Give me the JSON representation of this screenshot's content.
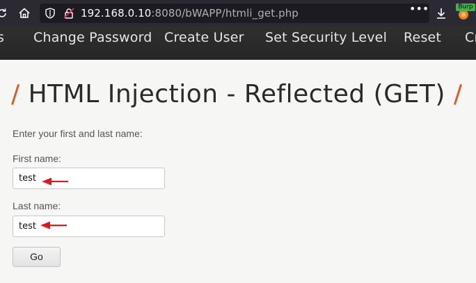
{
  "browser": {
    "url_host": "192.168.0.10",
    "url_port": ":8080",
    "url_path": "/bWAPP/htmli_get.php",
    "more_label": "•••",
    "burp_label": "Burp"
  },
  "nav": {
    "items": [
      {
        "label": "s"
      },
      {
        "label": "Change Password"
      },
      {
        "label": "Create User"
      },
      {
        "label": "Set Security Level"
      },
      {
        "label": "Reset"
      },
      {
        "label": "Cr"
      }
    ]
  },
  "page": {
    "slash": "/",
    "title": "HTML Injection - Reflected (GET)",
    "intro": "Enter your first and last name:",
    "first_label": "First name:",
    "first_value": "test",
    "last_label": "Last name:",
    "last_value": "test",
    "go_label": "Go"
  },
  "colors": {
    "accent": "#e05a1d",
    "annotation_arrow": "#e8141c"
  }
}
